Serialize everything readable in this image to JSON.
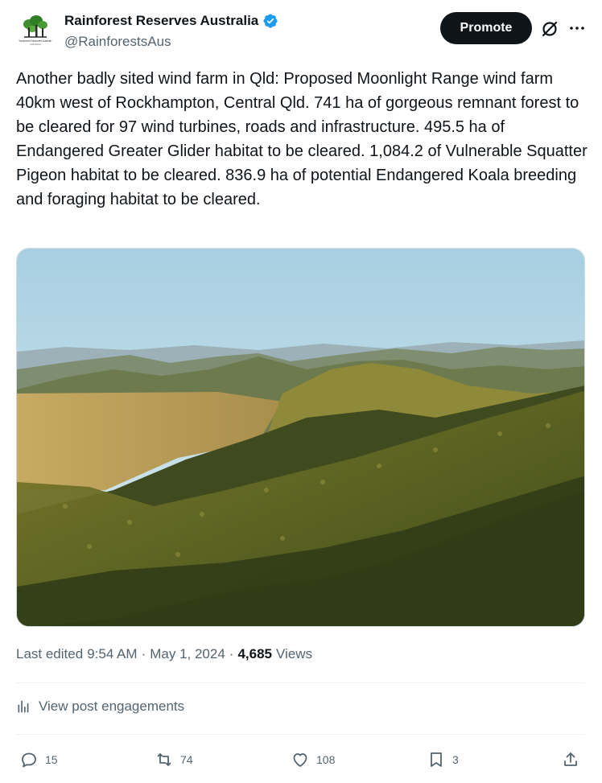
{
  "author": {
    "display_name": "Rainforest Reserves Australia",
    "handle": "@RainforestsAus",
    "avatar_caption": "Rainforest Reserves Australia",
    "verified": true,
    "verified_color": "#1d9bf0"
  },
  "header": {
    "promote_label": "Promote",
    "grok_icon": "grok-icon",
    "more_icon": "more-icon"
  },
  "tweet": {
    "text": "Another badly sited wind farm in Qld: Proposed Moonlight Range wind farm 40km west of Rockhampton, Central Qld. 741 ha of gorgeous remnant forest to be cleared for 97 wind turbines, roads and infrastructure. 495.5 ha of Endangered Greater Glider habitat to be cleared. 1,084.2 of Vulnerable Squatter Pigeon habitat to be cleared. 836.9 ha of potential Endangered Koala breeding and foraging habitat to be cleared."
  },
  "meta": {
    "edited_prefix": "Last edited",
    "time": "9:54 AM",
    "separator": "·",
    "date": "May 1, 2024",
    "views_count": "4,685",
    "views_label": "Views"
  },
  "engagements": {
    "label": "View post engagements"
  },
  "actions": {
    "replies": "15",
    "reposts": "74",
    "likes": "108",
    "bookmarks": "3"
  },
  "colors": {
    "text_primary": "#0f1419",
    "text_secondary": "#536471",
    "accent": "#1d9bf0",
    "button_dark": "#0f1419"
  }
}
